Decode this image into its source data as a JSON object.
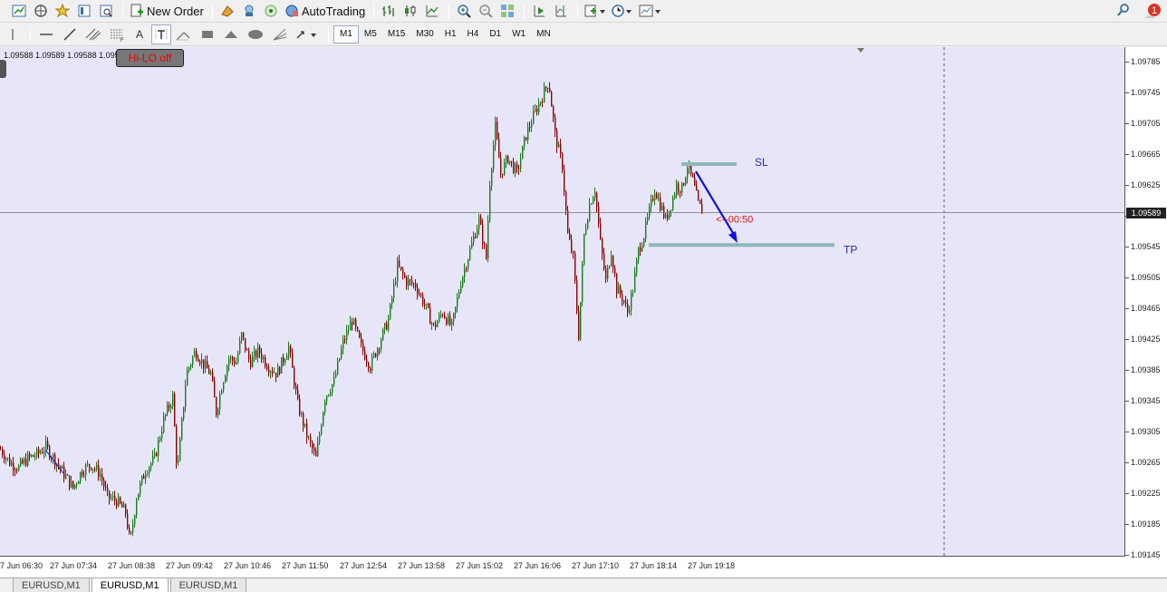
{
  "toolbar": {
    "new_order_label": "New Order",
    "autotrading_label": "AutoTrading",
    "notification_count": "1",
    "icons": [
      "new-chart-icon",
      "profiles-icon",
      "market-watch-icon",
      "navigator-icon",
      "terminal-icon",
      "strategy-tester-icon",
      "new-order-icon",
      "metaeditor-icon",
      "signals-icon",
      "autotrading-icon",
      "bar-chart-icon",
      "candlestick-icon",
      "line-chart-icon",
      "zoom-in-icon",
      "zoom-out-icon",
      "tile-windows-icon",
      "auto-scroll-icon",
      "chart-shift-icon",
      "indicators-icon",
      "periods-icon",
      "templates-icon",
      "search-icon",
      "notification-icon"
    ]
  },
  "drawing_tools": {
    "text_tool_label": "A",
    "timeframes": [
      "M1",
      "M5",
      "M15",
      "M30",
      "H1",
      "H4",
      "D1",
      "W1",
      "MN"
    ],
    "active_timeframe": "M1"
  },
  "chart": {
    "ohlc_readout": "1.09588 1.09589 1.09588 1.095",
    "hilo_button": "Hi-LO off",
    "current_price": "1.09589",
    "sl_label": "SL",
    "tp_label": "TP",
    "countdown_label": "<--00:50",
    "colors": {
      "bull": "#1a7a1a",
      "bear": "#8b0000",
      "background": "#e6e6f8",
      "level_line": "#8fb8b8",
      "arrow": "#1010e0",
      "countdown": "#e01010"
    }
  },
  "chart_data": {
    "type": "candlestick",
    "symbol": "EURUSD",
    "timeframe": "M1",
    "y_ticks": [
      "1.09785",
      "1.09745",
      "1.09705",
      "1.09665",
      "1.09625",
      "1.09585",
      "1.09545",
      "1.09505",
      "1.09465",
      "1.09425",
      "1.09385",
      "1.09345",
      "1.09305",
      "1.09265",
      "1.09225",
      "1.09185",
      "1.09145"
    ],
    "ylim": [
      1.0914,
      1.098
    ],
    "x_ticks": [
      "7 Jun 06:30",
      "27 Jun 07:34",
      "27 Jun 08:38",
      "27 Jun 09:42",
      "27 Jun 10:46",
      "27 Jun 11:50",
      "27 Jun 12:54",
      "27 Jun 13:58",
      "27 Jun 15:02",
      "27 Jun 16:06",
      "27 Jun 17:10",
      "27 Jun 18:14",
      "27 Jun 19:18"
    ],
    "current_price": 1.09589,
    "stop_loss": 1.09652,
    "take_profit": 1.09547,
    "path": [
      [
        0,
        1.09282
      ],
      [
        10,
        1.09265
      ],
      [
        20,
        1.09258
      ],
      [
        30,
        1.0927
      ],
      [
        40,
        1.09275
      ],
      [
        50,
        1.09285
      ],
      [
        60,
        1.09268
      ],
      [
        70,
        1.0925
      ],
      [
        80,
        1.09232
      ],
      [
        90,
        1.09255
      ],
      [
        100,
        1.09262
      ],
      [
        110,
        1.0925
      ],
      [
        118,
        1.0922
      ],
      [
        128,
        1.09215
      ],
      [
        138,
        1.092
      ],
      [
        143,
        1.0916
      ],
      [
        150,
        1.0922
      ],
      [
        160,
        1.09255
      ],
      [
        170,
        1.0927
      ],
      [
        180,
        1.0932
      ],
      [
        190,
        1.0935
      ],
      [
        195,
        1.0925
      ],
      [
        205,
        1.0938
      ],
      [
        215,
        1.0941
      ],
      [
        225,
        1.0939
      ],
      [
        232,
        1.0938
      ],
      [
        238,
        1.0933
      ],
      [
        245,
        1.0937
      ],
      [
        252,
        1.094
      ],
      [
        260,
        1.09395
      ],
      [
        266,
        1.0943
      ],
      [
        275,
        1.09395
      ],
      [
        285,
        1.0941
      ],
      [
        295,
        1.0939
      ],
      [
        305,
        1.0938
      ],
      [
        318,
        1.09415
      ],
      [
        328,
        1.0934
      ],
      [
        338,
        1.093
      ],
      [
        348,
        1.0927
      ],
      [
        358,
        1.0935
      ],
      [
        368,
        1.0937
      ],
      [
        378,
        1.0942
      ],
      [
        388,
        1.0945
      ],
      [
        398,
        1.09415
      ],
      [
        408,
        1.0939
      ],
      [
        418,
        1.0942
      ],
      [
        428,
        1.0945
      ],
      [
        438,
        1.0952
      ],
      [
        448,
        1.095
      ],
      [
        458,
        1.09495
      ],
      [
        468,
        1.0947
      ],
      [
        478,
        1.0944
      ],
      [
        488,
        1.0946
      ],
      [
        498,
        1.0944
      ],
      [
        508,
        1.095
      ],
      [
        518,
        1.0954
      ],
      [
        528,
        1.0958
      ],
      [
        536,
        1.0953
      ],
      [
        540,
        1.0963
      ],
      [
        546,
        1.097
      ],
      [
        552,
        1.0964
      ],
      [
        560,
        1.0966
      ],
      [
        570,
        1.0964
      ],
      [
        580,
        1.0969
      ],
      [
        590,
        1.0972
      ],
      [
        598,
        1.0974
      ],
      [
        605,
        1.0976
      ],
      [
        612,
        1.0969
      ],
      [
        620,
        1.0965
      ],
      [
        626,
        1.0956
      ],
      [
        632,
        1.0953
      ],
      [
        638,
        1.0943
      ],
      [
        644,
        1.0956
      ],
      [
        650,
        1.096
      ],
      [
        656,
        1.0962
      ],
      [
        662,
        1.0955
      ],
      [
        668,
        1.095
      ],
      [
        674,
        1.0954
      ],
      [
        680,
        1.0949
      ],
      [
        686,
        1.0948
      ],
      [
        692,
        1.0946
      ],
      [
        698,
        1.0949
      ],
      [
        704,
        1.0954
      ],
      [
        710,
        1.0956
      ],
      [
        716,
        1.0959
      ],
      [
        722,
        1.0962
      ],
      [
        728,
        1.096
      ],
      [
        734,
        1.0958
      ],
      [
        740,
        1.096
      ],
      [
        746,
        1.09625
      ],
      [
        752,
        1.0962
      ],
      [
        758,
        1.0965
      ],
      [
        764,
        1.0963
      ],
      [
        770,
        1.096
      ],
      [
        775,
        1.0959
      ]
    ]
  },
  "tabs": [
    {
      "label": "EURUSD,M1",
      "active": false
    },
    {
      "label": "EURUSD,M1",
      "active": true
    },
    {
      "label": "EURUSD,M1",
      "active": false
    }
  ]
}
